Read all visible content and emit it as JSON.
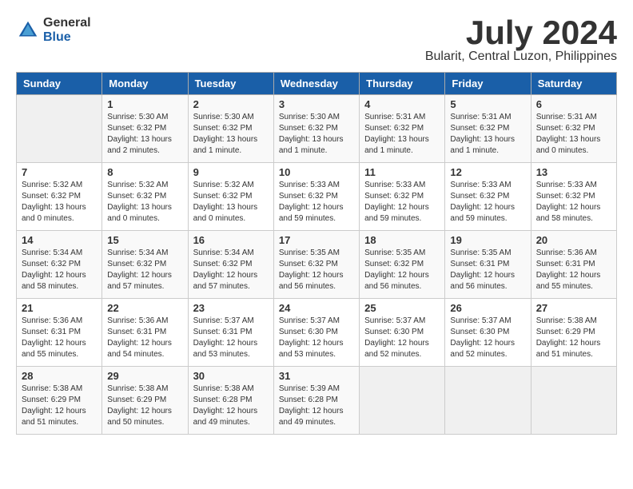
{
  "header": {
    "logo_general": "General",
    "logo_blue": "Blue",
    "month": "July 2024",
    "location": "Bularit, Central Luzon, Philippines"
  },
  "days_of_week": [
    "Sunday",
    "Monday",
    "Tuesday",
    "Wednesday",
    "Thursday",
    "Friday",
    "Saturday"
  ],
  "weeks": [
    [
      {
        "day": "",
        "empty": true
      },
      {
        "day": "1",
        "sunrise": "5:30 AM",
        "sunset": "6:32 PM",
        "daylight": "13 hours and 2 minutes."
      },
      {
        "day": "2",
        "sunrise": "5:30 AM",
        "sunset": "6:32 PM",
        "daylight": "13 hours and 1 minute."
      },
      {
        "day": "3",
        "sunrise": "5:30 AM",
        "sunset": "6:32 PM",
        "daylight": "13 hours and 1 minute."
      },
      {
        "day": "4",
        "sunrise": "5:31 AM",
        "sunset": "6:32 PM",
        "daylight": "13 hours and 1 minute."
      },
      {
        "day": "5",
        "sunrise": "5:31 AM",
        "sunset": "6:32 PM",
        "daylight": "13 hours and 1 minute."
      },
      {
        "day": "6",
        "sunrise": "5:31 AM",
        "sunset": "6:32 PM",
        "daylight": "13 hours and 0 minutes."
      }
    ],
    [
      {
        "day": "7",
        "sunrise": "5:32 AM",
        "sunset": "6:32 PM",
        "daylight": "13 hours and 0 minutes."
      },
      {
        "day": "8",
        "sunrise": "5:32 AM",
        "sunset": "6:32 PM",
        "daylight": "13 hours and 0 minutes."
      },
      {
        "day": "9",
        "sunrise": "5:32 AM",
        "sunset": "6:32 PM",
        "daylight": "13 hours and 0 minutes."
      },
      {
        "day": "10",
        "sunrise": "5:33 AM",
        "sunset": "6:32 PM",
        "daylight": "12 hours and 59 minutes."
      },
      {
        "day": "11",
        "sunrise": "5:33 AM",
        "sunset": "6:32 PM",
        "daylight": "12 hours and 59 minutes."
      },
      {
        "day": "12",
        "sunrise": "5:33 AM",
        "sunset": "6:32 PM",
        "daylight": "12 hours and 59 minutes."
      },
      {
        "day": "13",
        "sunrise": "5:33 AM",
        "sunset": "6:32 PM",
        "daylight": "12 hours and 58 minutes."
      }
    ],
    [
      {
        "day": "14",
        "sunrise": "5:34 AM",
        "sunset": "6:32 PM",
        "daylight": "12 hours and 58 minutes."
      },
      {
        "day": "15",
        "sunrise": "5:34 AM",
        "sunset": "6:32 PM",
        "daylight": "12 hours and 57 minutes."
      },
      {
        "day": "16",
        "sunrise": "5:34 AM",
        "sunset": "6:32 PM",
        "daylight": "12 hours and 57 minutes."
      },
      {
        "day": "17",
        "sunrise": "5:35 AM",
        "sunset": "6:32 PM",
        "daylight": "12 hours and 56 minutes."
      },
      {
        "day": "18",
        "sunrise": "5:35 AM",
        "sunset": "6:32 PM",
        "daylight": "12 hours and 56 minutes."
      },
      {
        "day": "19",
        "sunrise": "5:35 AM",
        "sunset": "6:31 PM",
        "daylight": "12 hours and 56 minutes."
      },
      {
        "day": "20",
        "sunrise": "5:36 AM",
        "sunset": "6:31 PM",
        "daylight": "12 hours and 55 minutes."
      }
    ],
    [
      {
        "day": "21",
        "sunrise": "5:36 AM",
        "sunset": "6:31 PM",
        "daylight": "12 hours and 55 minutes."
      },
      {
        "day": "22",
        "sunrise": "5:36 AM",
        "sunset": "6:31 PM",
        "daylight": "12 hours and 54 minutes."
      },
      {
        "day": "23",
        "sunrise": "5:37 AM",
        "sunset": "6:31 PM",
        "daylight": "12 hours and 53 minutes."
      },
      {
        "day": "24",
        "sunrise": "5:37 AM",
        "sunset": "6:30 PM",
        "daylight": "12 hours and 53 minutes."
      },
      {
        "day": "25",
        "sunrise": "5:37 AM",
        "sunset": "6:30 PM",
        "daylight": "12 hours and 52 minutes."
      },
      {
        "day": "26",
        "sunrise": "5:37 AM",
        "sunset": "6:30 PM",
        "daylight": "12 hours and 52 minutes."
      },
      {
        "day": "27",
        "sunrise": "5:38 AM",
        "sunset": "6:29 PM",
        "daylight": "12 hours and 51 minutes."
      }
    ],
    [
      {
        "day": "28",
        "sunrise": "5:38 AM",
        "sunset": "6:29 PM",
        "daylight": "12 hours and 51 minutes."
      },
      {
        "day": "29",
        "sunrise": "5:38 AM",
        "sunset": "6:29 PM",
        "daylight": "12 hours and 50 minutes."
      },
      {
        "day": "30",
        "sunrise": "5:38 AM",
        "sunset": "6:28 PM",
        "daylight": "12 hours and 49 minutes."
      },
      {
        "day": "31",
        "sunrise": "5:39 AM",
        "sunset": "6:28 PM",
        "daylight": "12 hours and 49 minutes."
      },
      {
        "day": "",
        "empty": true
      },
      {
        "day": "",
        "empty": true
      },
      {
        "day": "",
        "empty": true
      }
    ]
  ],
  "labels": {
    "sunrise": "Sunrise:",
    "sunset": "Sunset:",
    "daylight": "Daylight:"
  }
}
